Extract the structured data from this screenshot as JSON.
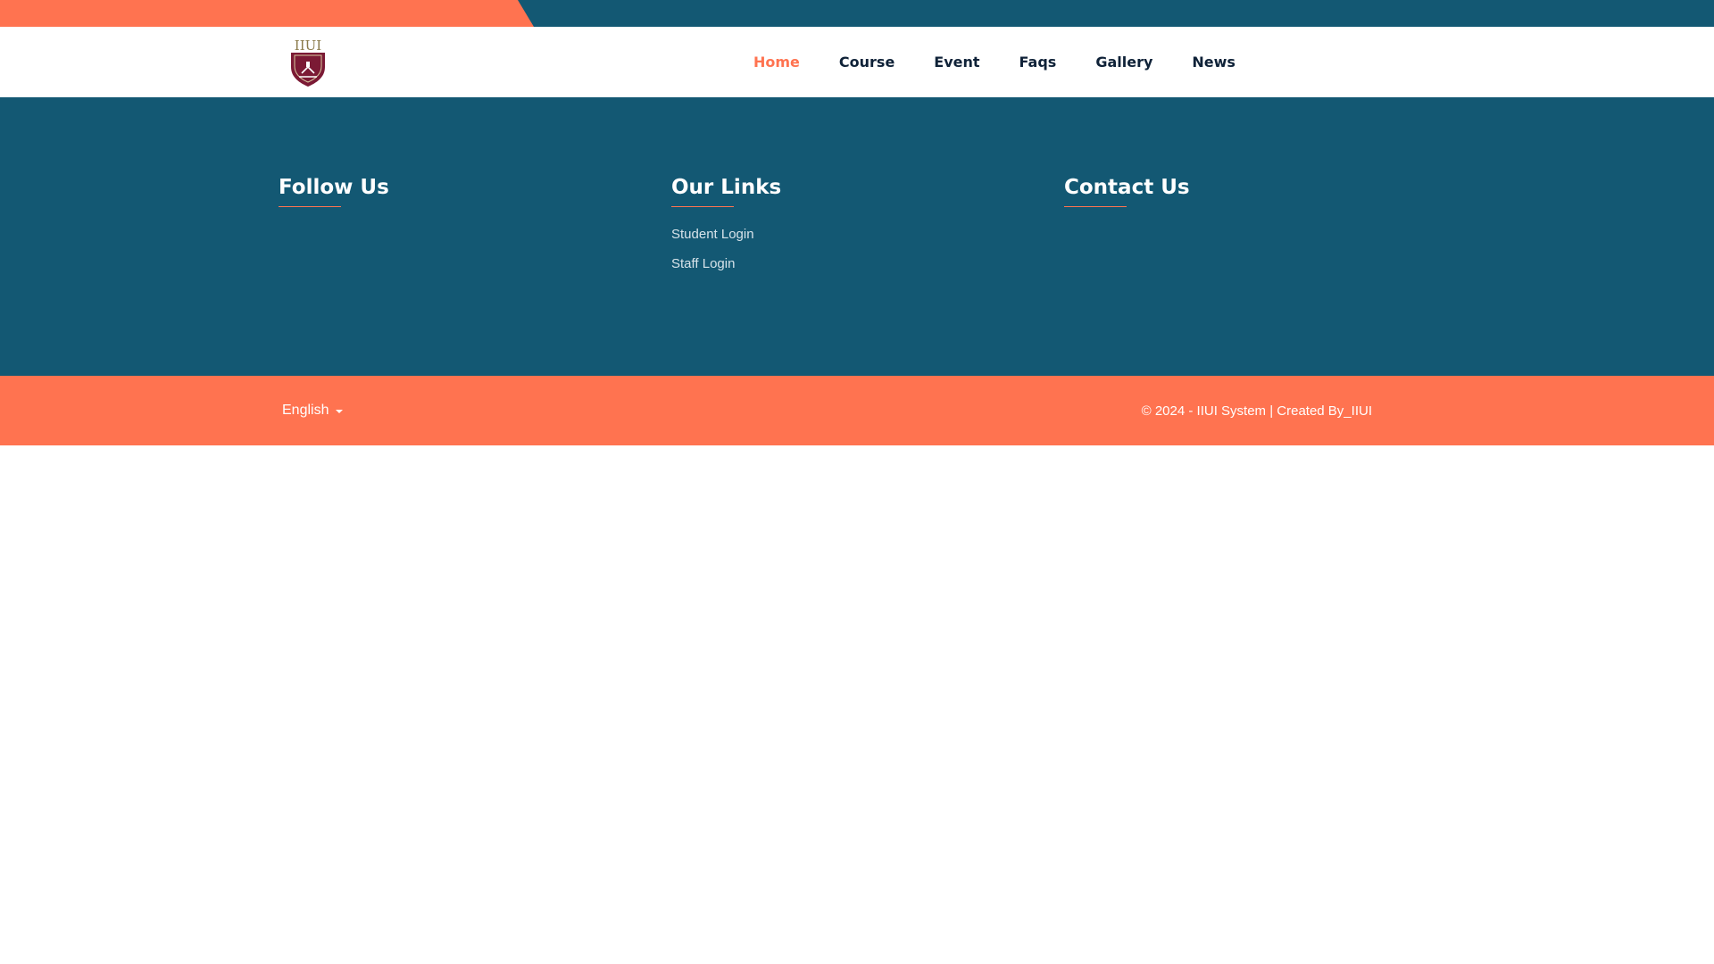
{
  "colors": {
    "primary": "#135873",
    "accent": "#ff7350",
    "nav_text": "#0f2238"
  },
  "brand": {
    "logo_text": "IIUI",
    "logo_icon": "university-shield-icon"
  },
  "nav": {
    "items": [
      {
        "label": "Home",
        "active": true
      },
      {
        "label": "Course"
      },
      {
        "label": "Event"
      },
      {
        "label": "Faqs"
      },
      {
        "label": "Gallery"
      },
      {
        "label": "News"
      }
    ]
  },
  "footer": {
    "follow": {
      "title": "Follow Us"
    },
    "links": {
      "title": "Our Links",
      "items": [
        "Student Login",
        "Staff Login"
      ]
    },
    "contact": {
      "title": "Contact Us"
    }
  },
  "bottom": {
    "language": "English",
    "copyright": "© 2024 - IIUI System | Created By_IIUI"
  }
}
